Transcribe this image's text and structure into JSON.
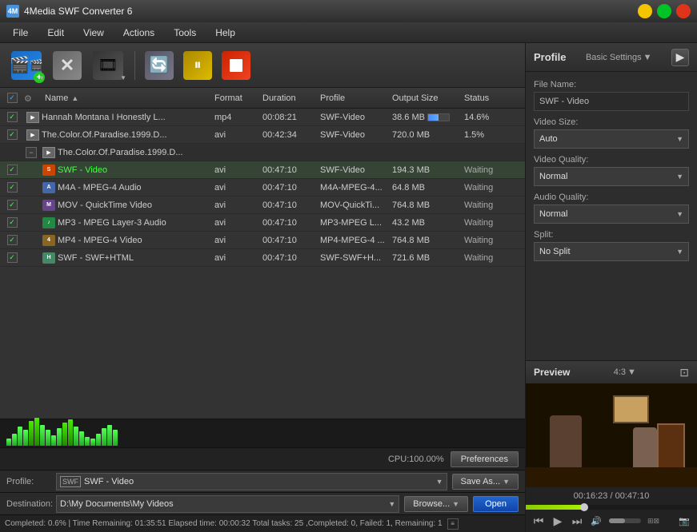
{
  "app": {
    "title": "4Media SWF Converter 6",
    "icon": "4M"
  },
  "menu": {
    "items": [
      "File",
      "Edit",
      "View",
      "Actions",
      "Tools",
      "Help"
    ]
  },
  "toolbar": {
    "buttons": [
      {
        "name": "add-file",
        "label": "Add File",
        "type": "film-add"
      },
      {
        "name": "remove",
        "label": "Remove",
        "type": "x"
      },
      {
        "name": "add-folder",
        "label": "Add Folder",
        "type": "film-new"
      },
      {
        "name": "refresh",
        "label": "Convert",
        "type": "refresh"
      },
      {
        "name": "pause",
        "label": "Pause",
        "type": "pause"
      },
      {
        "name": "stop",
        "label": "Stop",
        "type": "stop"
      }
    ]
  },
  "table": {
    "headers": {
      "name": "Name",
      "format": "Format",
      "duration": "Duration",
      "profile": "Profile",
      "output_size": "Output Size",
      "status": "Status"
    },
    "rows": [
      {
        "id": "row1",
        "type": "parent",
        "checked": true,
        "name": "Hannah Montana I Honestly L...",
        "format": "mp4",
        "duration": "00:08:21",
        "profile": "SWF-Video",
        "output_size": "38.6 MB",
        "progress": 14.6,
        "status": "14.6%",
        "has_progress_bar": true
      },
      {
        "id": "row2",
        "type": "parent",
        "checked": true,
        "name": "The.Color.Of.Paradise.1999.D...",
        "format": "avi",
        "duration": "00:42:34",
        "profile": "SWF-Video",
        "output_size": "720.0 MB",
        "progress": 1,
        "status": "1.5%",
        "has_progress_bar": false
      },
      {
        "id": "row3",
        "type": "group-header",
        "expanded": true,
        "name": "The.Color.Of.Paradise.1999.D...",
        "format": "",
        "duration": "",
        "profile": "",
        "output_size": "",
        "status": ""
      },
      {
        "id": "row3-1",
        "type": "child",
        "checked": true,
        "name": "SWF - Video",
        "file_type": "swf",
        "format": "avi",
        "duration": "00:47:10",
        "profile": "SWF-Video",
        "output_size": "194.3 MB",
        "status": "Waiting",
        "is_selected": true
      },
      {
        "id": "row3-2",
        "type": "child",
        "checked": true,
        "name": "M4A - MPEG-4 Audio",
        "file_type": "m4a",
        "format": "avi",
        "duration": "00:47:10",
        "profile": "M4A-MPEG-4...",
        "output_size": "64.8 MB",
        "status": "Waiting"
      },
      {
        "id": "row3-3",
        "type": "child",
        "checked": true,
        "name": "MOV - QuickTime Video",
        "file_type": "mov",
        "format": "avi",
        "duration": "00:47:10",
        "profile": "MOV-QuickTi...",
        "output_size": "764.8 MB",
        "status": "Waiting"
      },
      {
        "id": "row3-4",
        "type": "child",
        "checked": true,
        "name": "MP3 - MPEG Layer-3 Audio",
        "file_type": "mp3",
        "format": "avi",
        "duration": "00:47:10",
        "profile": "MP3-MPEG L...",
        "output_size": "43.2 MB",
        "status": "Waiting"
      },
      {
        "id": "row3-5",
        "type": "child",
        "checked": true,
        "name": "MP4 - MPEG-4 Video",
        "file_type": "mp4",
        "format": "avi",
        "duration": "00:47:10",
        "profile": "MP4-MPEG-4 ...",
        "output_size": "764.8 MB",
        "status": "Waiting"
      },
      {
        "id": "row3-6",
        "type": "child",
        "checked": true,
        "name": "SWF - SWF+HTML",
        "file_type": "html",
        "format": "avi",
        "duration": "00:47:10",
        "profile": "SWF-SWF+H...",
        "output_size": "721.6 MB",
        "status": "Waiting"
      }
    ]
  },
  "audio_bars": [
    8,
    14,
    22,
    18,
    28,
    32,
    24,
    18,
    12,
    20,
    26,
    30,
    22,
    16,
    10,
    8,
    14,
    20,
    24,
    18
  ],
  "status_bottom": {
    "cpu": "CPU:100.00%",
    "preferences_btn": "Preferences"
  },
  "profile_bar": {
    "label": "Profile:",
    "value": "SWF - Video",
    "save_as_btn": "Save As...",
    "dropdown_arrow": "▼"
  },
  "destination_bar": {
    "label": "Destination:",
    "value": "D:\\My Documents\\My Videos",
    "browse_btn": "Browse...",
    "open_btn": "Open",
    "dropdown_arrow": "▼"
  },
  "status_bar": {
    "text": "Completed: 0.6% | Time Remaining: 01:35:51 Elapsed time: 00:00:32 Total tasks: 25 ,Completed: 0, Failed: 1, Remaining: 1"
  },
  "right_panel": {
    "title": "Profile",
    "basic_settings": "Basic Settings",
    "nav_arrow": "▶",
    "fields": {
      "file_name_label": "File Name:",
      "file_name_value": "SWF - Video",
      "video_size_label": "Video Size:",
      "video_size_value": "Auto",
      "video_quality_label": "Video Quality:",
      "video_quality_value": "Normal",
      "audio_quality_label": "Audio Quality:",
      "audio_quality_value": "Normal",
      "split_label": "Split:",
      "split_value": "No Split"
    },
    "preview": {
      "title": "Preview",
      "ratio": "4:3",
      "time": "00:16:23 / 00:47:10",
      "controls": {
        "play": "▶",
        "prev": "⏮",
        "next": "⏭",
        "volume": "🔊"
      }
    }
  }
}
